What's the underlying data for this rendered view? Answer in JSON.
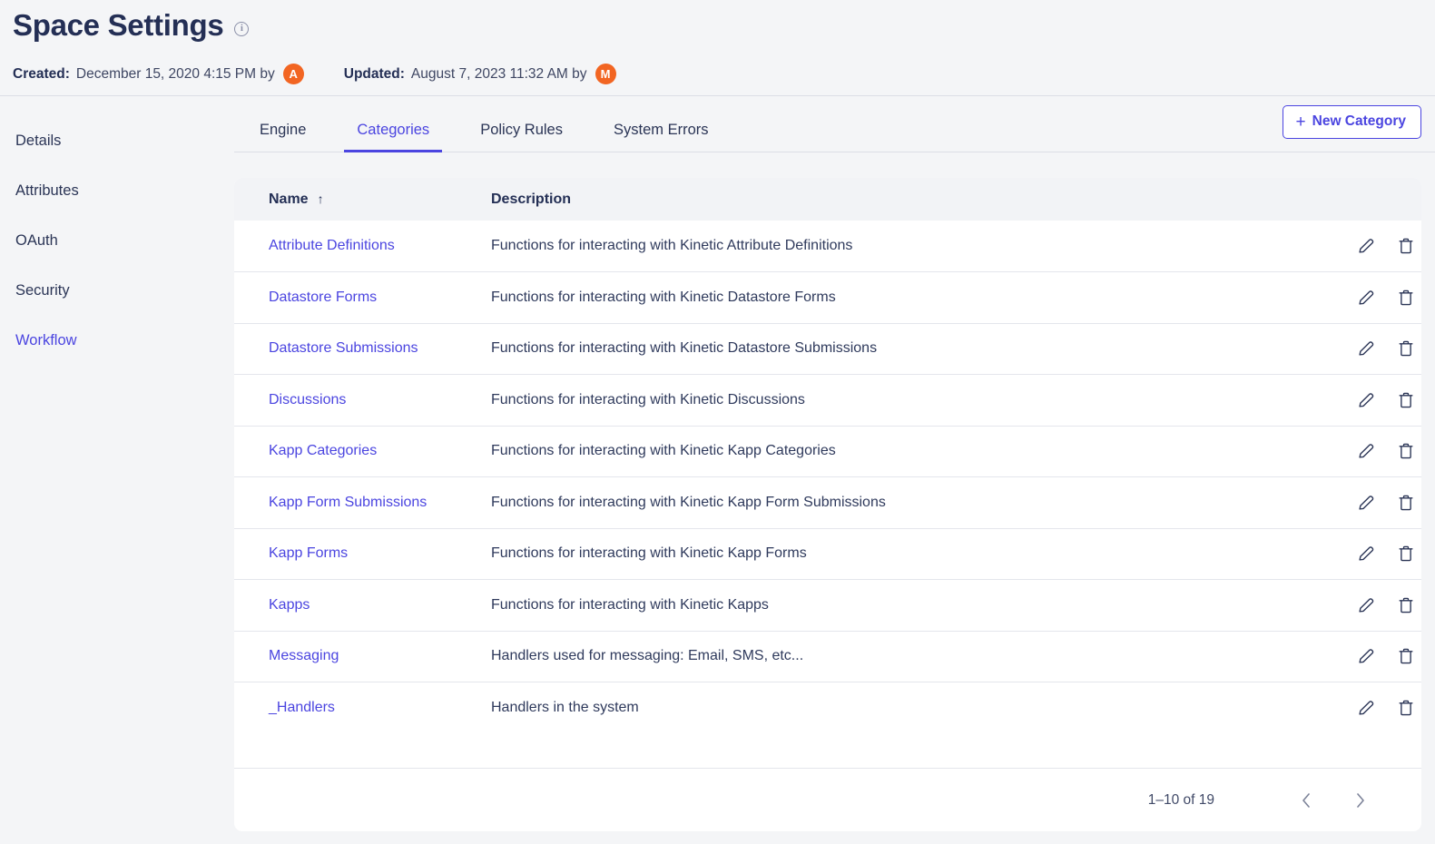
{
  "header": {
    "title": "Space Settings",
    "info_icon": "info-icon",
    "created_label": "Created:",
    "created_value": "December 15, 2020 4:15 PM by",
    "created_avatar": "A",
    "updated_label": "Updated:",
    "updated_value": "August 7, 2023 11:32 AM by",
    "updated_avatar": "M"
  },
  "colors": {
    "accent": "#4b45e0",
    "title": "#242f55",
    "avatar": "#f26522",
    "page_bg": "#f4f5f7",
    "card_bg": "#ffffff",
    "header_row_bg": "#f2f3f6",
    "divider": "#e4e6ec"
  },
  "sidebar": {
    "items": [
      {
        "label": "Details",
        "active": false
      },
      {
        "label": "Attributes",
        "active": false
      },
      {
        "label": "OAuth",
        "active": false
      },
      {
        "label": "Security",
        "active": false
      },
      {
        "label": "Workflow",
        "active": true
      }
    ]
  },
  "tabs": [
    {
      "label": "Engine",
      "active": false
    },
    {
      "label": "Categories",
      "active": true
    },
    {
      "label": "Policy Rules",
      "active": false
    },
    {
      "label": "System Errors",
      "active": false
    }
  ],
  "toolbar": {
    "new_category_label": "New Category",
    "plus_glyph": "+"
  },
  "table": {
    "columns": [
      {
        "label": "Name",
        "sort": "ascending",
        "sort_glyph": "↑"
      },
      {
        "label": "Description"
      }
    ],
    "rows": [
      {
        "name": "Attribute Definitions",
        "description": "Functions for interacting with Kinetic Attribute Definitions",
        "wrapped": false
      },
      {
        "name": "Datastore Forms",
        "description": "Functions for interacting with Kinetic Datastore Forms",
        "wrapped": false
      },
      {
        "name": "Datastore Submissions",
        "description": "Functions for interacting with Kinetic Datastore Submissions",
        "wrapped": true
      },
      {
        "name": "Discussions",
        "description": "Functions for interacting with Kinetic Discussions",
        "wrapped": false
      },
      {
        "name": "Kapp Categories",
        "description": "Functions for interacting with Kinetic Kapp Categories",
        "wrapped": false
      },
      {
        "name": "Kapp Form Submissions",
        "description": "Functions for interacting with Kinetic Kapp Form Submissions",
        "wrapped": true
      },
      {
        "name": "Kapp Forms",
        "description": "Functions for interacting with Kinetic Kapp Forms",
        "wrapped": false
      },
      {
        "name": "Kapps",
        "description": "Functions for interacting with Kinetic Kapps",
        "wrapped": false
      },
      {
        "name": "Messaging",
        "description": "Handlers used for messaging: Email, SMS, etc...",
        "wrapped": false
      },
      {
        "name": "_Handlers",
        "description": "Handlers in the system",
        "wrapped": false
      }
    ],
    "row_actions": [
      {
        "name": "edit-icon",
        "title": "Edit"
      },
      {
        "name": "delete-icon",
        "title": "Delete"
      }
    ]
  },
  "pagination": {
    "range_label": "1–10 of 19",
    "prev_glyph": "‹",
    "next_glyph": "›"
  }
}
